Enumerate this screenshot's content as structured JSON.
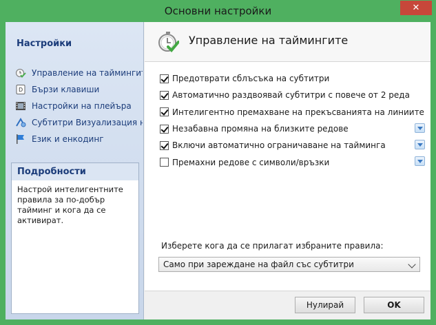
{
  "window": {
    "title": "Основни настройки",
    "close_label": "✕"
  },
  "sidebar": {
    "title": "Настройки",
    "items": [
      {
        "label": "Управление на таймингите",
        "icon": "timing-check-icon"
      },
      {
        "label": "Бързи клавиши",
        "icon": "keyboard-key-icon"
      },
      {
        "label": "Настройки на плейъра",
        "icon": "film-icon"
      },
      {
        "label": "Субтитри Визуализация на",
        "icon": "subtitle-visual-icon"
      },
      {
        "label": "Език и енкодинг",
        "icon": "flag-icon"
      }
    ]
  },
  "details": {
    "title": "Подробности",
    "text": "Настрой интелигентните правила за по-добър тайминг и кога да се активират."
  },
  "main": {
    "title": "Управление на таймингите",
    "options": [
      {
        "label": "Предотврати сблъсъка на субтитри",
        "checked": true,
        "has_dropdown": false
      },
      {
        "label": "Автоматично раздвоявай субтитри с повече от 2 реда",
        "checked": true,
        "has_dropdown": false
      },
      {
        "label": "Интелигентно премахване на прекъсванията на линиите",
        "checked": true,
        "has_dropdown": false
      },
      {
        "label": "Незабавна промяна на близките редове",
        "checked": true,
        "has_dropdown": true
      },
      {
        "label": "Включи автоматично ограничаване на тайминга",
        "checked": true,
        "has_dropdown": true
      },
      {
        "label": "Премахни редове с символи/връзки",
        "checked": false,
        "has_dropdown": true
      }
    ],
    "apply_label": "Изберете кога да се прилагат избраните правила:",
    "apply_value": "Само при зареждане на файл със субтитри"
  },
  "footer": {
    "reset_label": "Нулирай",
    "ok_label": "OK"
  },
  "colors": {
    "frame": "#4fb060",
    "accent": "#1b3c7a",
    "close": "#c7473a"
  }
}
